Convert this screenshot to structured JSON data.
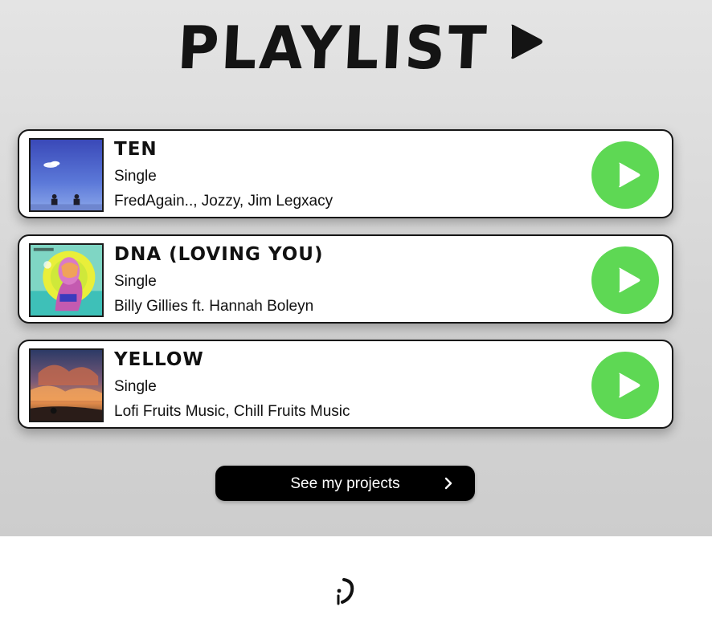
{
  "header": {
    "title": "PLAYLIST",
    "title_icon": "play-triangle-icon"
  },
  "tracks": [
    {
      "title": "TEN",
      "type": "Single",
      "artists": "FredAgain.., Jozzy, Jim Legxacy",
      "cover_icon": "album-cover-sky-benches",
      "play_icon": "play-icon"
    },
    {
      "title": "DNA (LOVING YOU)",
      "type": "Single",
      "artists": "Billy Gillies ft. Hannah Boleyn",
      "cover_icon": "album-cover-colorful-portrait",
      "play_icon": "play-icon"
    },
    {
      "title": "YELLOW",
      "type": "Single",
      "artists": "Lofi Fruits Music, Chill Fruits Music",
      "cover_icon": "album-cover-sunset-clouds",
      "play_icon": "play-icon"
    }
  ],
  "cta": {
    "label": "See my projects",
    "icon": "chevron-right-icon"
  },
  "footer": {
    "logo_icon": "logo-mark-icon"
  },
  "colors": {
    "play_green": "#5ed854",
    "card_border": "#161616",
    "section_bg": "#d6d6d6",
    "button_bg": "#000000"
  }
}
